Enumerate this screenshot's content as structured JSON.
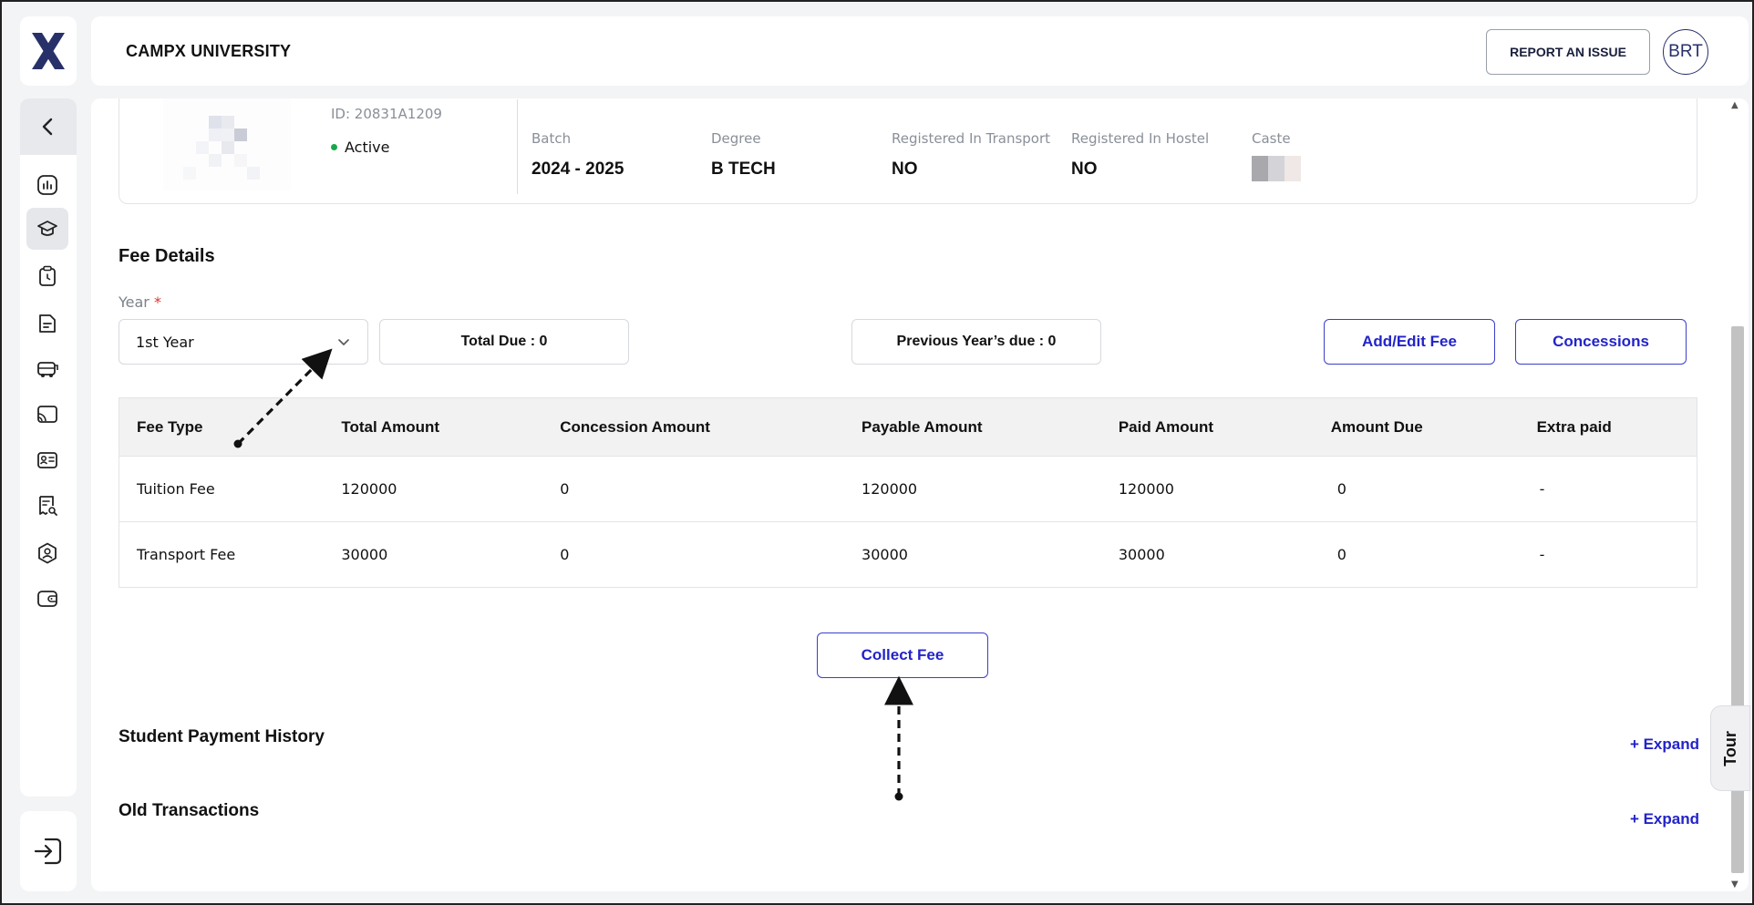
{
  "header": {
    "title": "CAMPX UNIVERSITY",
    "report_label": "REPORT AN ISSUE",
    "avatar_initials": "BRT"
  },
  "profile": {
    "id_text": "ID: 20831A1209",
    "status": "Active",
    "fields": [
      {
        "label": "Batch",
        "value": "2024 - 2025"
      },
      {
        "label": "Degree",
        "value": "B TECH"
      },
      {
        "label": "Registered In Transport",
        "value": "NO"
      },
      {
        "label": "Registered In Hostel",
        "value": "NO"
      },
      {
        "label": "Caste",
        "value": ""
      }
    ]
  },
  "fee_details": {
    "title": "Fee Details",
    "year_label": "Year",
    "year_required_mark": "*",
    "year_value": "1st Year",
    "total_due": "Total Due : 0",
    "previous_due": "Previous Year’s due : 0",
    "add_edit_label": "Add/Edit Fee",
    "concessions_label": "Concessions",
    "table": {
      "headers": [
        "Fee Type",
        "Total Amount",
        "Concession Amount",
        "Payable Amount",
        "Paid Amount",
        "Amount Due",
        "Extra paid"
      ],
      "rows": [
        [
          "Tuition Fee",
          "120000",
          "0",
          "120000",
          "120000",
          "0",
          "-"
        ],
        [
          "Transport Fee",
          "30000",
          "0",
          "30000",
          "30000",
          "0",
          "-"
        ]
      ]
    },
    "collect_label": "Collect Fee"
  },
  "sections": {
    "payment_history": "Student Payment History",
    "old_transactions": "Old Transactions",
    "expand_label": "+ Expand"
  },
  "tour_label": "Tour",
  "colors": {
    "accent": "#2323c9",
    "active_dot": "#18a84a",
    "logo": "#28306a"
  }
}
